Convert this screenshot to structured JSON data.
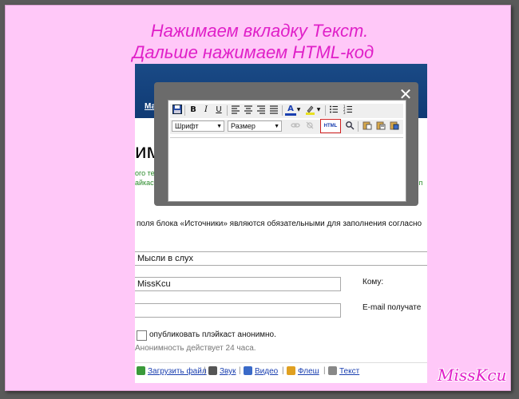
{
  "caption": {
    "line1": "Нажимаем вкладку Текст.",
    "line2": "Дальше нажимаем HTML-код"
  },
  "signature": "MissKcu",
  "page": {
    "topbar_link": "Маг",
    "heading": "имо",
    "green_left_line1": "ого тер",
    "green_left_line2": "айкаст в",
    "green_right_line1": "е",
    "green_right_line2": "е п",
    "required_note": "поля блока «Источники» являются обязательными для заполнения согласно",
    "title_field_value": "Мысли в слух",
    "name_field_value": "MissKcu",
    "email_field_value": "",
    "to_label": "Кому:",
    "email_label": "E-mail получате",
    "anon_checkbox_label": "опубликовать плэйкаст анонимно.",
    "anon_note": "Анонимность действует 24 часа.",
    "upload": {
      "file": "Загрузить файл",
      "sound": "Звук",
      "video": "Видео",
      "flash": "Флеш",
      "text": "Текст"
    }
  },
  "editor": {
    "close_glyph": "✕",
    "bold": "B",
    "italic": "I",
    "underline": "U",
    "text_color_glyph": "A",
    "font_select": "Шрифт",
    "size_select": "Размер",
    "html_button": "HTML"
  },
  "colors": {
    "caption": "#e020c8",
    "background": "#ffc8f8",
    "topbar": "#1a4a86",
    "highlight": "#d02020"
  }
}
